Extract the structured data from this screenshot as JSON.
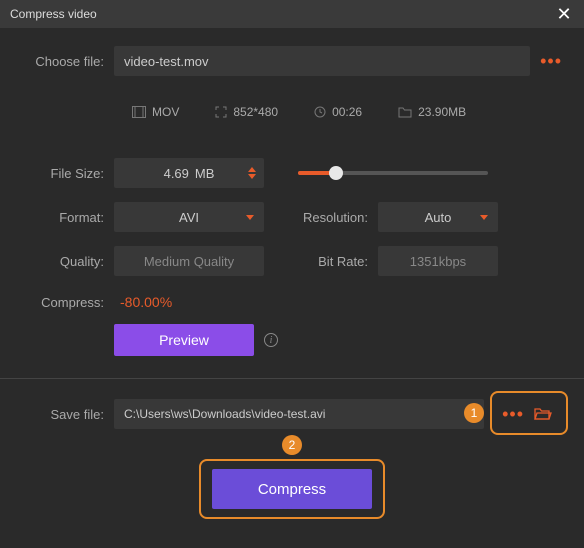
{
  "window": {
    "title": "Compress video"
  },
  "choose_file": {
    "label": "Choose file:",
    "value": "video-test.mov"
  },
  "meta": {
    "format": "MOV",
    "dimensions": "852*480",
    "duration": "00:26",
    "size": "23.90MB"
  },
  "file_size": {
    "label": "File Size:",
    "value": "4.69",
    "unit": "MB"
  },
  "format": {
    "label": "Format:",
    "value": "AVI"
  },
  "resolution": {
    "label": "Resolution:",
    "value": "Auto"
  },
  "quality": {
    "label": "Quality:",
    "value": "Medium Quality"
  },
  "bit_rate": {
    "label": "Bit Rate:",
    "value": "1351kbps"
  },
  "compress_ratio": {
    "label": "Compress:",
    "value": "-80.00%"
  },
  "preview": {
    "label": "Preview"
  },
  "save_file": {
    "label": "Save file:",
    "value": "C:\\Users\\ws\\Downloads\\video-test.avi"
  },
  "compress_button": {
    "label": "Compress"
  },
  "annotations": {
    "badge1": "1",
    "badge2": "2"
  }
}
